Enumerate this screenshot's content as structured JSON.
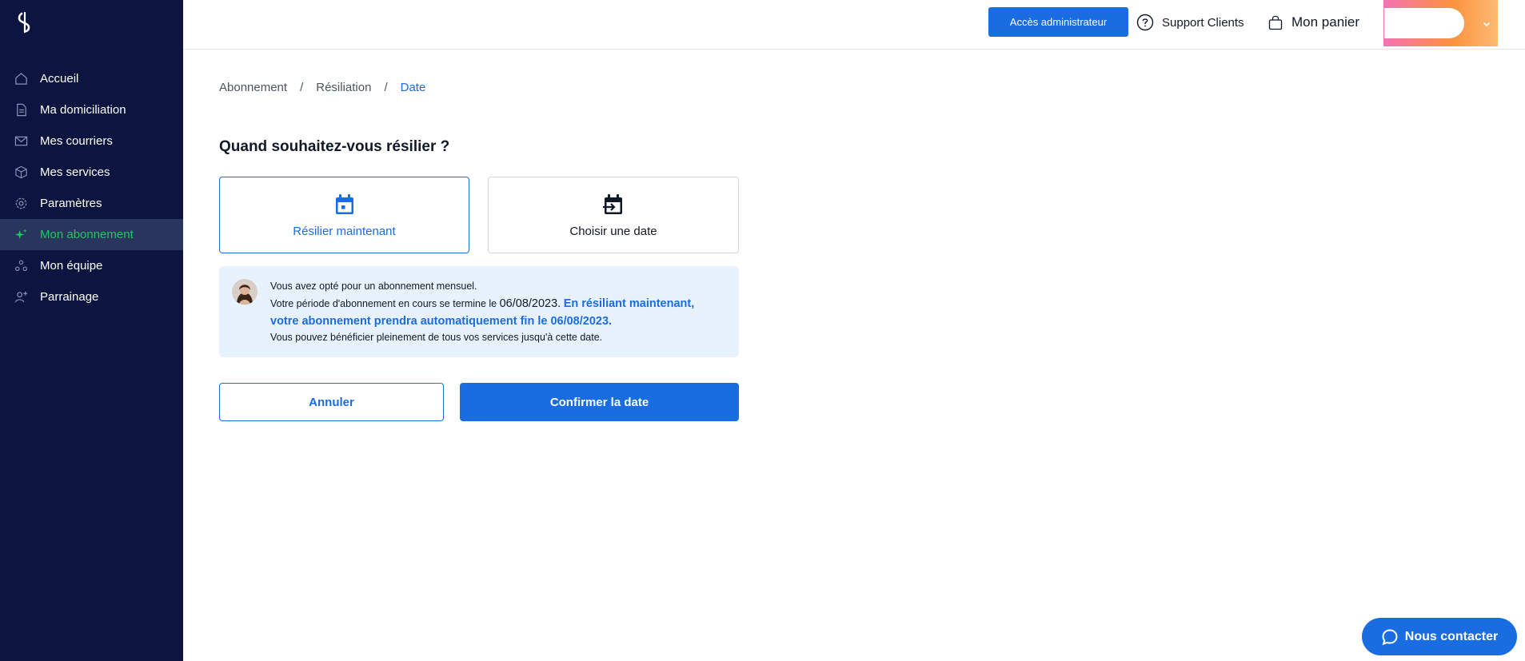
{
  "sidebar": {
    "items": [
      {
        "label": "Accueil",
        "icon": "home-icon",
        "active": false
      },
      {
        "label": "Ma domiciliation",
        "icon": "document-icon",
        "active": false
      },
      {
        "label": "Mes courriers",
        "icon": "mail-icon",
        "active": false
      },
      {
        "label": "Mes services",
        "icon": "box-icon",
        "active": false
      },
      {
        "label": "Paramètres",
        "icon": "gear-icon",
        "active": false
      },
      {
        "label": "Mon abonnement",
        "icon": "sparkle-icon",
        "active": true
      },
      {
        "label": "Mon équipe",
        "icon": "team-icon",
        "active": false
      },
      {
        "label": "Parrainage",
        "icon": "referral-icon",
        "active": false
      }
    ]
  },
  "header": {
    "admin_label": "Accès administrateur",
    "support_label": "Support Clients",
    "cart_label": "Mon panier"
  },
  "breadcrumb": {
    "items": [
      "Abonnement",
      "Résiliation",
      "Date"
    ],
    "separator": "/"
  },
  "main": {
    "title": "Quand souhaitez-vous résilier ?",
    "options": [
      {
        "label": "Résilier maintenant",
        "icon": "calendar-icon",
        "selected": true
      },
      {
        "label": "Choisir une date",
        "icon": "calendar-arrow-icon",
        "selected": false
      }
    ],
    "info": {
      "line1": "Vous avez opté pour un abonnement mensuel.",
      "line2_prefix": "Votre période d'abonnement en cours se termine le ",
      "line2_date": "06/08/2023.",
      "line2_highlight_a": "En résiliant maintenant,",
      "line2_highlight_b": "votre abonnement prendra automatiquement fin le 06/08/2023.",
      "line3": "Vous pouvez bénéficier pleinement de tous vos services jusqu'à cette date."
    },
    "cancel_label": "Annuler",
    "confirm_label": "Confirmer la date"
  },
  "contact": {
    "label": "Nous contacter"
  },
  "colors": {
    "sidebar_bg": "#0b1540",
    "accent": "#1a6de0",
    "active_nav": "#22c55e",
    "info_bg": "#e8f2fd"
  }
}
